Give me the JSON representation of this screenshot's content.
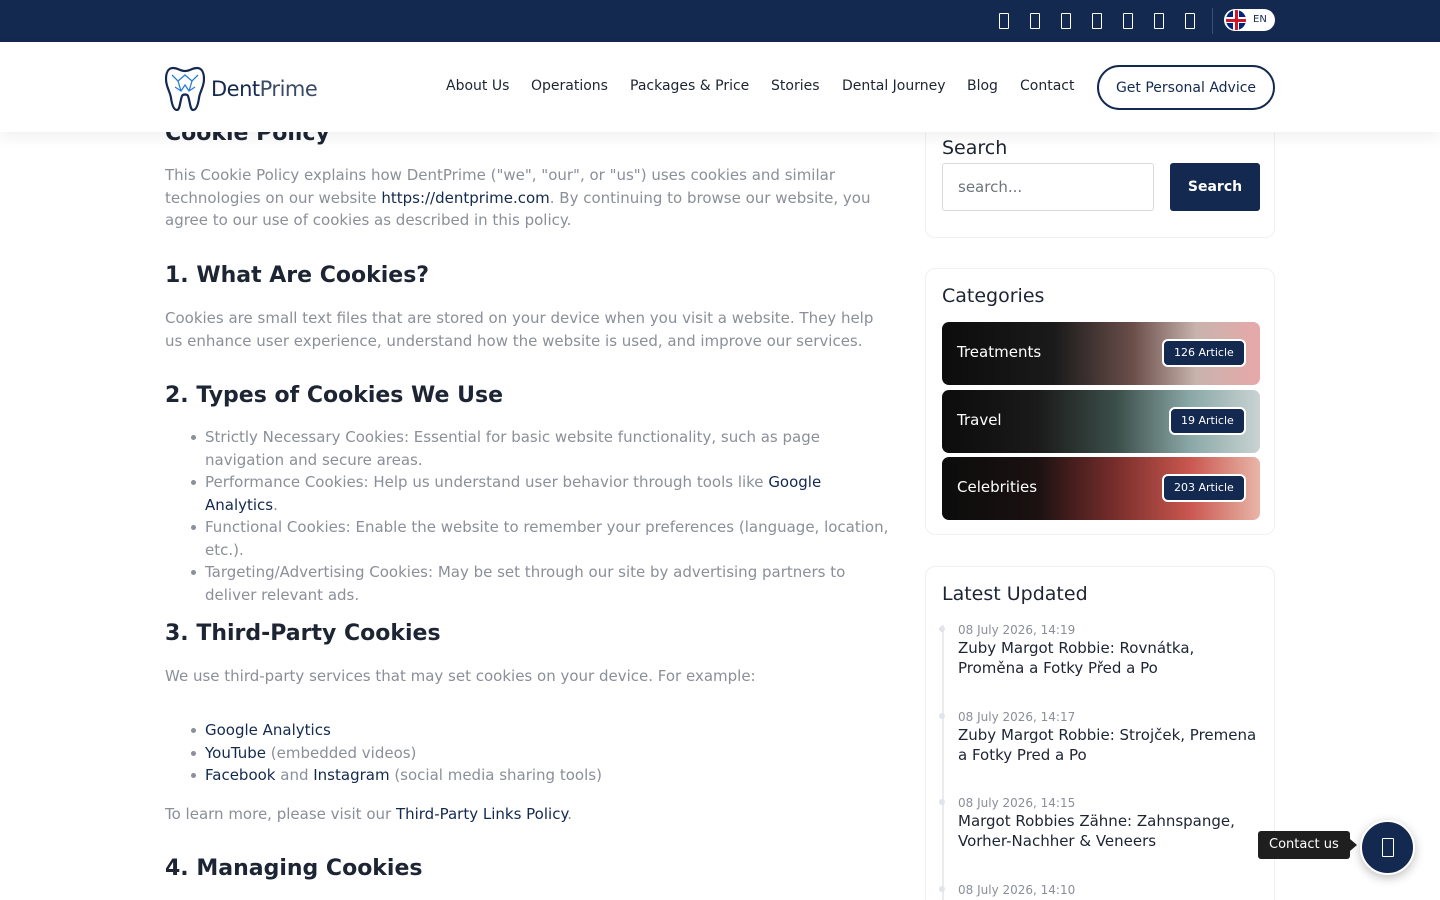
{
  "topbar": {
    "social_icons": [
      "facebook-icon",
      "instagram-icon",
      "youtube-icon",
      "x-icon",
      "tiktok-icon",
      "linkedin-icon",
      "pinterest-icon"
    ],
    "language": {
      "code": "EN",
      "flag": "uk-flag-icon"
    },
    "background": "#13294f"
  },
  "header": {
    "brand": {
      "dark": "Dent",
      "light": "Prime"
    },
    "nav": [
      {
        "label": "About Us"
      },
      {
        "label": "Operations"
      },
      {
        "label": "Packages & Price"
      },
      {
        "label": "Stories"
      },
      {
        "label": "Dental Journey"
      },
      {
        "label": "Blog"
      },
      {
        "label": "Contact"
      }
    ],
    "cta_label": "Get Personal Advice"
  },
  "content": {
    "title": "Cookie Policy",
    "intro": {
      "before": "This Cookie Policy explains how DentPrime (\"we\", \"our\", or \"us\") uses cookies and similar technologies on our website ",
      "link": "https://dentprime.com",
      "after": ". By continuing to browse our website, you agree to our use of cookies as described in this policy."
    },
    "s1": {
      "heading": "1. What Are Cookies?",
      "text": "Cookies are small text files that are stored on your device when you visit a website. They help us enhance user experience, understand how the website is used, and improve our services."
    },
    "s2": {
      "heading": "2. Types of Cookies We Use",
      "items": [
        {
          "text": "Strictly Necessary Cookies: Essential for basic website functionality, such as page navigation and secure areas."
        },
        {
          "before": "Performance Cookies: Help us understand user behavior through tools like ",
          "link": "Google Analytics",
          "after": "."
        },
        {
          "text": "Functional Cookies: Enable the website to remember your preferences (language, location, etc.)."
        },
        {
          "text": "Targeting/Advertising Cookies: May be set through our site by advertising partners to deliver relevant ads."
        }
      ]
    },
    "s3": {
      "heading": "3. Third-Party Cookies",
      "text": "We use third-party services that may set cookies on your device. For example:",
      "items": [
        {
          "link": "Google Analytics"
        },
        {
          "link": "YouTube",
          "after": " (embedded videos)"
        },
        {
          "link": "Facebook",
          "mid": " and ",
          "link2": "Instagram",
          "after": " (social media sharing tools)"
        }
      ],
      "learn_before": "To learn more, please visit our ",
      "learn_link": "Third-Party Links Policy",
      "learn_after": "."
    },
    "s4": {
      "heading": "4. Managing Cookies"
    }
  },
  "sidebar": {
    "search": {
      "title": "Search",
      "placeholder": "search...",
      "button": "Search"
    },
    "categories": {
      "title": "Categories",
      "items": [
        {
          "label": "Treatments",
          "badge": "126 Article"
        },
        {
          "label": "Travel",
          "badge": "19 Article"
        },
        {
          "label": "Celebrities",
          "badge": "203 Article"
        }
      ]
    },
    "latest": {
      "title": "Latest Updated",
      "posts": [
        {
          "date": "08 July 2026, 14:19",
          "title": "Zuby Margot Robbie: Rovnátka, Proměna a Fotky Před a Po"
        },
        {
          "date": "08 July 2026, 14:17",
          "title": "Zuby Margot Robbie: Strojček, Premena a Fotky Pred a Po"
        },
        {
          "date": "08 July 2026, 14:15",
          "title": "Margot Robbies Zähne: Zahnspange, Vorher-Nachher & Veneers"
        },
        {
          "date": "08 July 2026, 14:10",
          "title": ""
        }
      ]
    }
  },
  "contact_widget": {
    "label": "Contact us",
    "icon": "whatsapp-icon"
  },
  "colors": {
    "brand": "#13294f",
    "text_muted": "#8a8f98",
    "link": "#13294f"
  }
}
